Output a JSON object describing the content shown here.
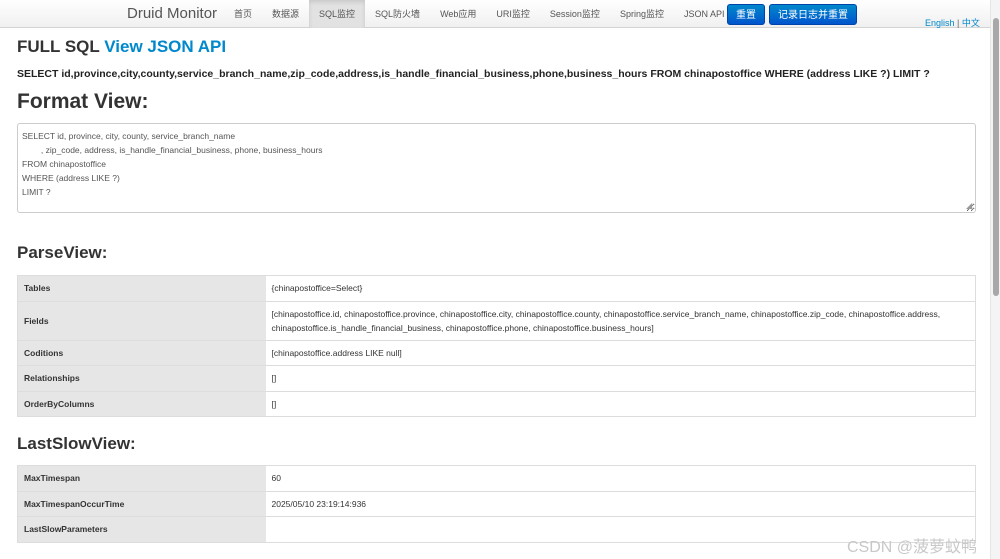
{
  "navbar": {
    "brand": "Druid Monitor",
    "items": [
      {
        "label": "首页",
        "active": false
      },
      {
        "label": "数据源",
        "active": false
      },
      {
        "label": "SQL监控",
        "active": true
      },
      {
        "label": "SQL防火墙",
        "active": false
      },
      {
        "label": "Web应用",
        "active": false
      },
      {
        "label": "URI监控",
        "active": false
      },
      {
        "label": "Session监控",
        "active": false
      },
      {
        "label": "Spring监控",
        "active": false
      },
      {
        "label": "JSON API",
        "active": false
      }
    ],
    "reset_label": "重置",
    "log_reset_label": "记录日志并重置",
    "lang_en": "English",
    "lang_sep": "|",
    "lang_zh": "中文"
  },
  "header": {
    "full_sql_label": "FULL SQL",
    "json_api_link": "View JSON API",
    "sql": "SELECT id,province,city,county,service_branch_name,zip_code,address,is_handle_financial_business,phone,business_hours FROM chinapostoffice WHERE (address LIKE ?) LIMIT ?"
  },
  "format_view": {
    "heading": "Format View:",
    "text": "SELECT id, province, city, county, service_branch_name\n\t, zip_code, address, is_handle_financial_business, phone, business_hours\nFROM chinapostoffice\nWHERE (address LIKE ?)\nLIMIT ?"
  },
  "parse_view": {
    "heading": "ParseView:",
    "rows": [
      {
        "key": "Tables",
        "value": "{chinapostoffice=Select}"
      },
      {
        "key": "Fields",
        "value": "[chinapostoffice.id, chinapostoffice.province, chinapostoffice.city, chinapostoffice.county, chinapostoffice.service_branch_name, chinapostoffice.zip_code, chinapostoffice.address, chinapostoffice.is_handle_financial_business, chinapostoffice.phone, chinapostoffice.business_hours]"
      },
      {
        "key": "Coditions",
        "value": "[chinapostoffice.address LIKE null]"
      },
      {
        "key": "Relationships",
        "value": "[]"
      },
      {
        "key": "OrderByColumns",
        "value": "[]"
      }
    ]
  },
  "last_slow_view": {
    "heading": "LastSlowView:",
    "rows": [
      {
        "key": "MaxTimespan",
        "value": "60"
      },
      {
        "key": "MaxTimespanOccurTime",
        "value": "2025/05/10 23:19:14:936"
      },
      {
        "key": "LastSlowParameters",
        "value": ""
      }
    ]
  },
  "watermark": "CSDN @菠萝蚊鸭"
}
